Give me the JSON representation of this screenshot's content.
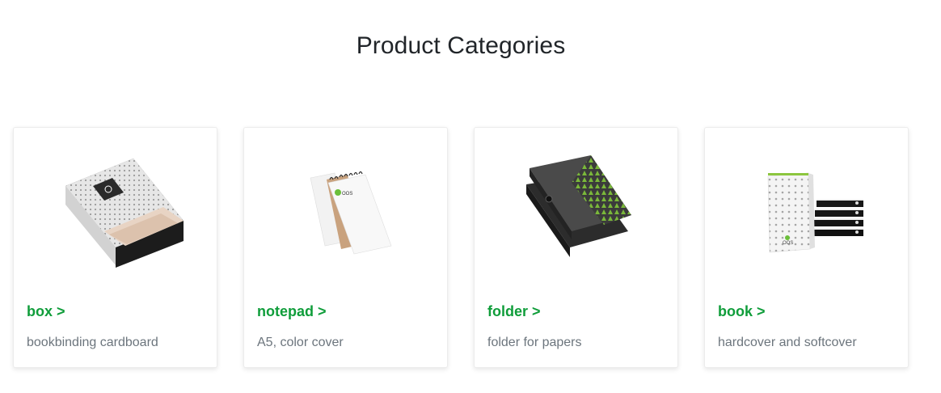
{
  "page": {
    "title": "Product Categories"
  },
  "theme": {
    "accent": "#0f9d3a",
    "heading": "#212529",
    "muted": "#6c757d"
  },
  "categories": [
    {
      "title": "box >",
      "description": "bookbinding cardboard",
      "image": "box-product-image"
    },
    {
      "title": "notepad >",
      "description": "A5, color cover",
      "image": "notepad-product-image"
    },
    {
      "title": "folder >",
      "description": "folder for papers",
      "image": "folder-product-image"
    },
    {
      "title": "book >",
      "description": "hardcover and softcover",
      "image": "book-product-image"
    }
  ]
}
